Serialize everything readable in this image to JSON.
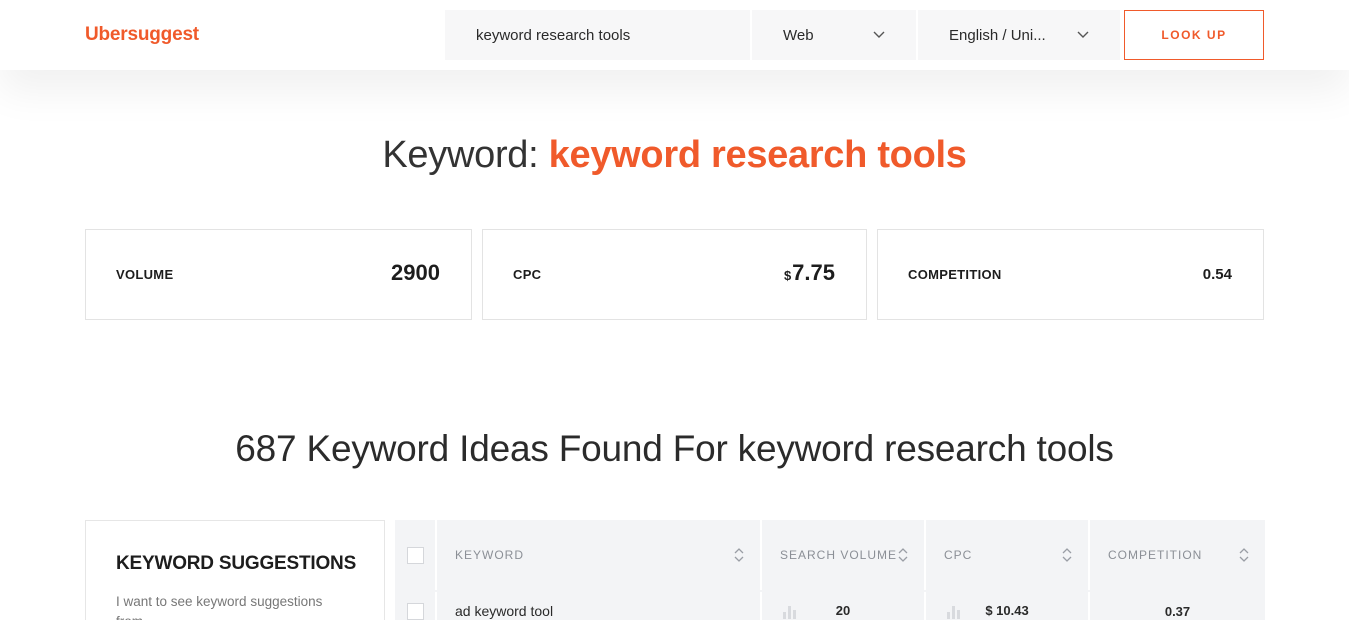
{
  "header": {
    "logo": "Ubersuggest",
    "search": {
      "value": "keyword research tools",
      "placeholder": ""
    },
    "type_select": {
      "selected": "Web"
    },
    "lang_select": {
      "selected": "English / Uni..."
    },
    "lookup_label": "LOOK UP"
  },
  "colors": {
    "accent": "#f05a2b",
    "text": "#1d1d1d",
    "muted": "#8b8f96",
    "table_bg": "#f3f4f6"
  },
  "overview": {
    "title_prefix": "Keyword:",
    "keyword": "keyword research tools",
    "cards": {
      "volume": {
        "label": "VOLUME",
        "value": "2900"
      },
      "cpc": {
        "label": "CPC",
        "currency": "$",
        "value": "7.75"
      },
      "competition": {
        "label": "COMPETITION",
        "value": "0.54"
      }
    }
  },
  "ideas": {
    "title": "687 Keyword Ideas Found For keyword research tools"
  },
  "sidebar": {
    "title": "KEYWORD SUGGESTIONS",
    "description": "I want to see keyword suggestions from..."
  },
  "table": {
    "headers": {
      "keyword": "KEYWORD",
      "volume": "SEARCH VOLUME",
      "cpc": "CPC",
      "competition": "COMPETITION"
    },
    "rows": [
      {
        "keyword": "ad keyword tool",
        "volume": "20",
        "cpc": "$ 10.43",
        "competition": "0.37"
      }
    ]
  },
  "icons": {
    "dropdown": "chevron-down-icon",
    "sort": "sort-icon",
    "trend": "trend-bars-icon"
  }
}
